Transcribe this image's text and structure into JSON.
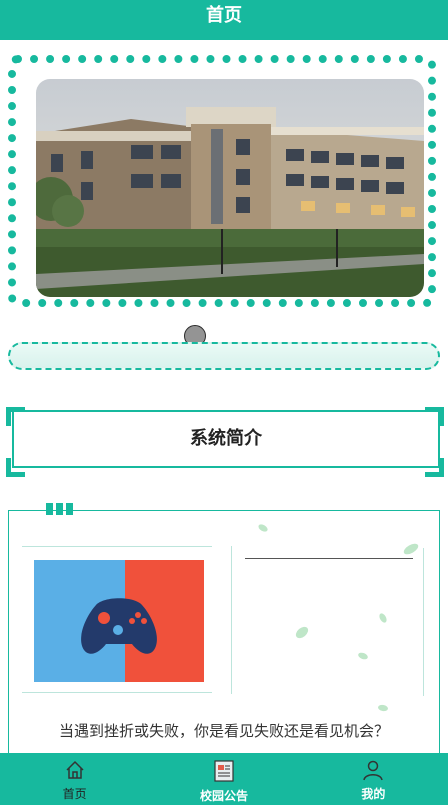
{
  "header": {
    "title": "首页"
  },
  "banner": {
    "image": "campus-building-photo"
  },
  "notice": {
    "text": ""
  },
  "section": {
    "title": "系统简介"
  },
  "intro": {
    "quote": "当遇到挫折或失败，你是看见失败还是看见机会？"
  },
  "bottom_nav": [
    {
      "label": "首页",
      "icon": "home-icon"
    },
    {
      "label": "校园公告",
      "icon": "notice-icon"
    },
    {
      "label": "我的",
      "icon": "user-icon"
    }
  ],
  "colors": {
    "accent": "#17b99e",
    "game_left": "#5aafe6",
    "game_right": "#f0513b",
    "controller": "#233a6b"
  }
}
